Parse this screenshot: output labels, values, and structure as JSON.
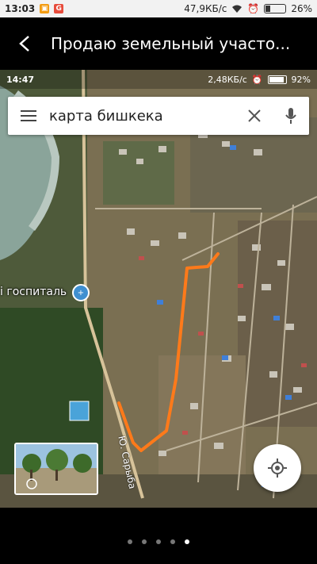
{
  "device_status": {
    "time": "13:03",
    "speed": "47,9КБ/с",
    "battery": "26%",
    "battery_level": 0.26,
    "app_icons": [
      "orange-app-icon",
      "google-icon"
    ]
  },
  "appbar": {
    "back_icon": "arrow-back-icon",
    "title": "Продаю земельный участо..."
  },
  "screenshot": {
    "status": {
      "time": "14:47",
      "speed": "2,48КБ/с",
      "battery": "92%",
      "battery_level": 0.92
    },
    "search": {
      "menu_icon": "menu-icon",
      "query": "карта бишкека",
      "clear_icon": "close-icon",
      "mic_icon": "mic-icon"
    },
    "map": {
      "place_label": "і госпиталь",
      "street_label": "Ю. Сарыба",
      "street_view_icon": "street-view-icon",
      "locate_icon": "my-location-icon",
      "route_color": "#ff7a1a"
    }
  },
  "pager": {
    "count": 5,
    "active_index": 4
  }
}
